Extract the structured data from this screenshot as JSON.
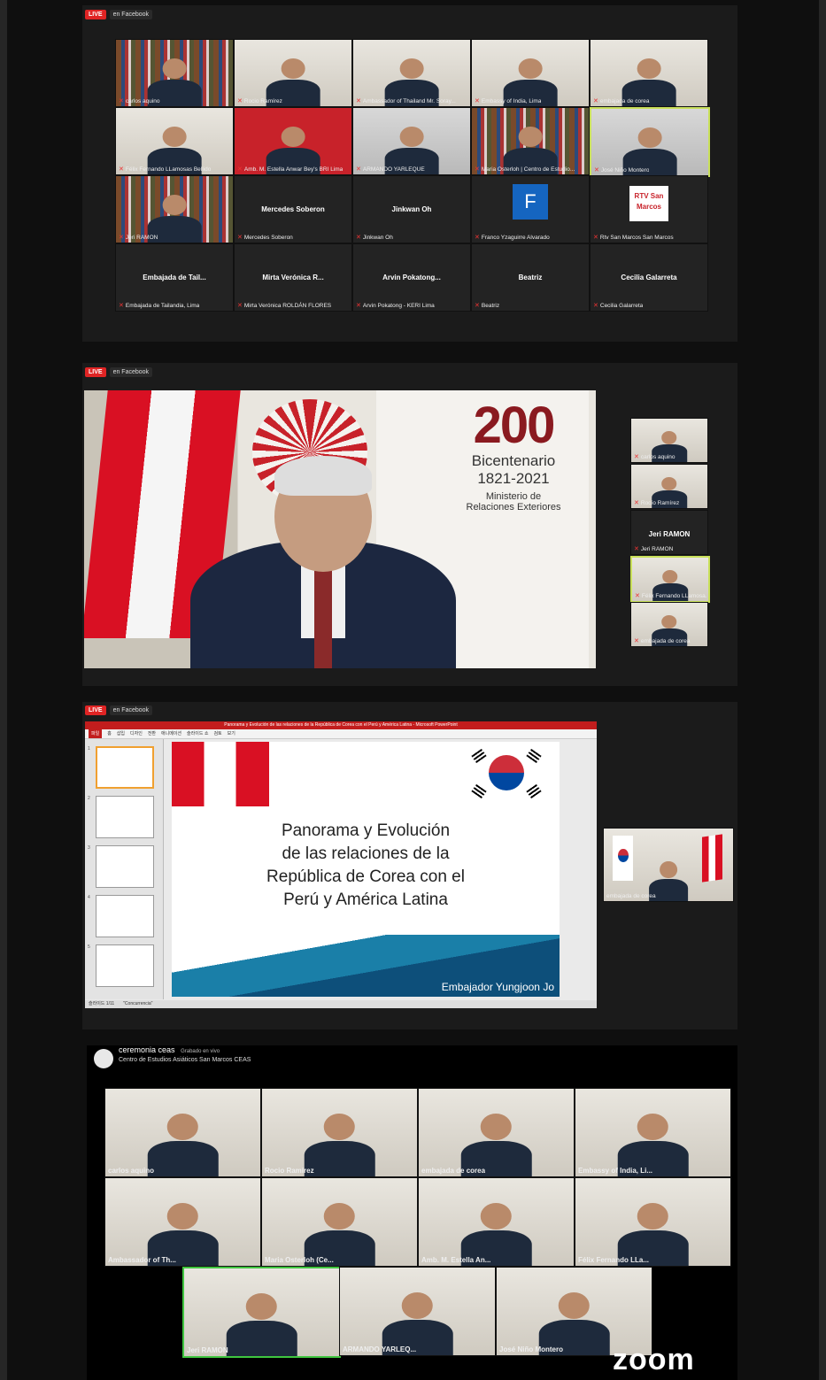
{
  "live": {
    "label": "LIVE",
    "destination": "en Facebook"
  },
  "gallery1": [
    {
      "name": "carlos aquino",
      "bg": "shelf"
    },
    {
      "name": "Rocio Ramírez",
      "bg": "wallwhite"
    },
    {
      "name": "Ambassador of Thailand Mr. Soray...",
      "bg": "wallwhite"
    },
    {
      "name": "Embassy of India, Lima",
      "bg": "wallwhite"
    },
    {
      "name": "embajada de corea",
      "bg": "wallwhite"
    },
    {
      "name": "Félix Fernando LLamosas Bellido",
      "bg": "wallwhite"
    },
    {
      "name": "Amb. M. Estella Anwar Bey's BRI Lima",
      "bg": "red-banner"
    },
    {
      "name": "ARMANDO YARLEQUE",
      "bg": "wallgray"
    },
    {
      "name": "Maria Osterloh | Centro de Estudio...",
      "bg": "shelf"
    },
    {
      "name": "José Niño Montero",
      "bg": "wallgray",
      "active": true
    },
    {
      "name": "Jeri RAMON",
      "bg": "shelf"
    },
    {
      "name": "Mercedes Soberon",
      "center": "Mercedes Soberon"
    },
    {
      "name": "Jinkwan Oh",
      "center": "Jinkwan Oh"
    },
    {
      "name": "Franco Yzaguirre Alvarado",
      "avatar_letter": "F"
    },
    {
      "name": "Rtv San Marcos San Marcos",
      "logo": "RTV San Marcos"
    },
    {
      "name": "Embajada de Tailandia, Lima",
      "center": "Embajada de Tail..."
    },
    {
      "name": "Mirta Verónica ROLDÁN FLORES",
      "center": "Mirta Verónica R..."
    },
    {
      "name": "Arvin Pokatong - KERI Lima",
      "center": "Arvin Pokatong..."
    },
    {
      "name": "Beatriz",
      "center": "Beatriz"
    },
    {
      "name": "Cecilia Galarreta",
      "center": "Cecilia Galarreta"
    }
  ],
  "speaker": {
    "logo_number": "200",
    "logo_line1": "Bicentenario",
    "logo_line2": "1821-2021",
    "logo_line3": "Ministerio de",
    "logo_line4": "Relaciones Exteriores",
    "thumbs": [
      {
        "name": "carlos aquino"
      },
      {
        "name": "Rocío Ramírez"
      },
      {
        "name": "Jeri RAMON",
        "center": "Jeri RAMON"
      },
      {
        "name": "Félix Fernando LLamosa...",
        "active": true
      },
      {
        "name": "embajada de corea"
      }
    ]
  },
  "slide": {
    "title_bar": "Panorama y Evolución de las relaciones de la República de Corea con el Perú y América Latina - Microsoft PowerPoint",
    "menu": [
      "파일",
      "홈",
      "삽입",
      "디자인",
      "전환",
      "애니메이션",
      "슬라이드 쇼",
      "검토",
      "보기"
    ],
    "title_lines": [
      "Panorama y Evolución",
      "de las relaciones de la",
      "República de Corea con el",
      "Perú y América Latina"
    ],
    "author": "Embajador Yungjoon Jo",
    "thumb_numbers": [
      "1",
      "2",
      "3",
      "4",
      "5"
    ],
    "status_left": "슬라이드 1/11",
    "status_theme": "\"Concurrencia\"",
    "side_name": "embajada de corea"
  },
  "recording": {
    "title": "ceremonia ceas",
    "subtitle": "Grabado en vivo",
    "channel": "Centro de Estudios Asiáticos San Marcos CEAS",
    "tiles": [
      {
        "name": "carlos aquino"
      },
      {
        "name": "Rocio Ramírez"
      },
      {
        "name": "embajada de corea"
      },
      {
        "name": "Embassy of India, Li..."
      },
      {
        "name": "Ambassador of Th..."
      },
      {
        "name": "Maria Osterloh (Ce..."
      },
      {
        "name": "Amb. M. Estella An..."
      },
      {
        "name": "Félix Fernando LLa..."
      },
      {
        "name": "Jeri RAMON",
        "green": true
      },
      {
        "name": "ARMANDO YARLEQ..."
      },
      {
        "name": "José Niño Montero"
      }
    ],
    "brand": "zoom"
  }
}
